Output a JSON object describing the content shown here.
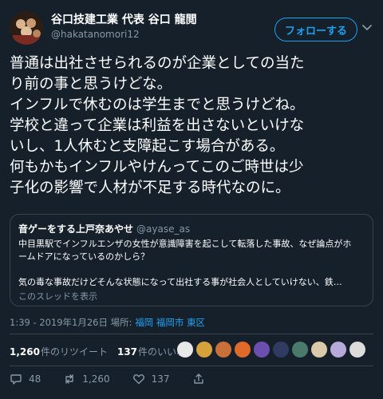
{
  "header": {
    "display_name": "谷口技建工業 代表 谷口 龍閲",
    "handle": "@hakatanomori12",
    "follow_label": "フォローする"
  },
  "tweet": {
    "lines": [
      "普通は出社させられるのが企業としての当た",
      "り前の事と思うけどな。",
      "インフルで休むのは学生までと思うけどね。",
      "学校と違って企業は利益を出さないといけな",
      "いし、1人休むと支障起こす場合がある。",
      "何もかもインフルやけんってこのご時世は少",
      "子化の影響で人材が不足する時代なのに。"
    ]
  },
  "quote": {
    "name": "音ゲーをする上戸奈あやせ",
    "handle": "@ayase_as",
    "lines": [
      "中目黒駅でインフルエンザの女性が意識障害を起こして転落した事故、なぜ論点がホ",
      "ームドアになっているのかしら？"
    ],
    "line3": "気の毒な事故だけどそんな状態になって出社する事が社会人としていけない、鉄…",
    "thread_link": "このスレッドを表示"
  },
  "meta": {
    "time": "1:39 - 2019年1月26日 場所: ",
    "location": "福岡 福岡市 東区"
  },
  "stats": {
    "retweets_count": "1,260",
    "retweets_label": "件のリツイート",
    "likes_count": "137",
    "likes_label": "件のいいね"
  },
  "liker_colors": [
    "#e8e8e8",
    "#d6a23c",
    "#c9703a",
    "#e06a2a",
    "#6a4fb0",
    "#2f3b60",
    "#4a7a6a",
    "#d9c9a8",
    "#b7a9d9",
    "#dcdcdc"
  ],
  "actions": {
    "reply_count": "48",
    "retweet_count": "1,260",
    "like_count": "137"
  },
  "colors": {
    "background": "#15202b",
    "accent": "#1da1f2",
    "muted": "#8899a6",
    "border": "#38444d"
  }
}
